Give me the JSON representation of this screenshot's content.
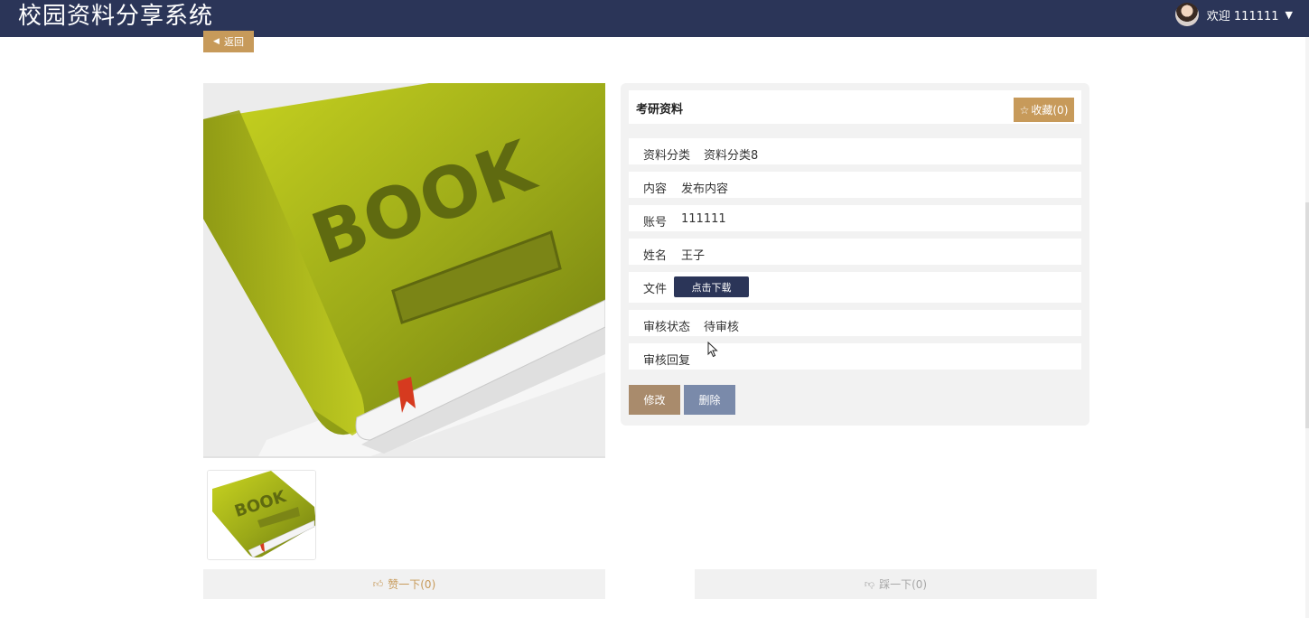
{
  "header": {
    "app_title": "校园资料分享系统",
    "welcome_text": "欢迎 111111",
    "caret_icon": "caret-down-icon"
  },
  "back_label": "返回",
  "resource": {
    "title": "考研资料",
    "favorite_label": "收藏(0)",
    "fields": [
      {
        "label": "资料分类",
        "value": "资料分类8"
      },
      {
        "label": "内容",
        "value": "发布内容"
      },
      {
        "label": "账号",
        "value": "111111"
      },
      {
        "label": "姓名",
        "value": "王子"
      },
      {
        "label": "文件",
        "value": ""
      },
      {
        "label": "审核状态",
        "value": "待审核"
      },
      {
        "label": "审核回复",
        "value": ""
      }
    ],
    "download_label": "点击下载",
    "edit_label": "修改",
    "delete_label": "删除"
  },
  "images": {
    "main_text": "BOOK",
    "thumb_text": "BOOK"
  },
  "reactions": {
    "like_label": "赞一下(0)",
    "dislike_label": "踩一下(0)"
  },
  "colors": {
    "header_bg": "#2b3558",
    "accent": "#c79a5a",
    "edit_btn": "#a98b6c",
    "delete_btn": "#7a8aaa"
  }
}
